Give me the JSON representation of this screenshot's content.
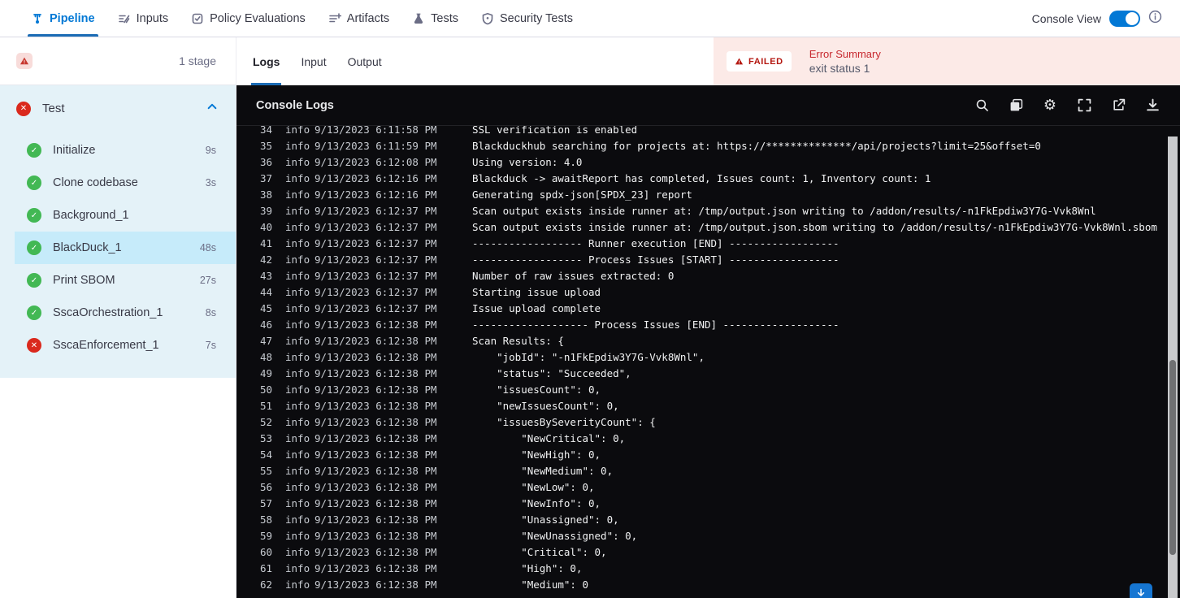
{
  "topnav": {
    "tabs": [
      {
        "label": "Pipeline",
        "icon": "pipeline-icon",
        "active": true
      },
      {
        "label": "Inputs",
        "icon": "inputs-icon"
      },
      {
        "label": "Policy Evaluations",
        "icon": "policy-evaluations-icon"
      },
      {
        "label": "Artifacts",
        "icon": "artifacts-icon"
      },
      {
        "label": "Tests",
        "icon": "tests-icon"
      },
      {
        "label": "Security Tests",
        "icon": "security-tests-icon"
      }
    ],
    "console_view_label": "Console View",
    "console_view_on": true
  },
  "sidebar": {
    "stage_count": "1 stage",
    "stage": {
      "name": "Test",
      "status": "failed"
    },
    "steps": [
      {
        "name": "Initialize",
        "duration": "9s",
        "status": "success"
      },
      {
        "name": "Clone codebase",
        "duration": "3s",
        "status": "success"
      },
      {
        "name": "Background_1",
        "duration": "",
        "status": "success"
      },
      {
        "name": "BlackDuck_1",
        "duration": "48s",
        "status": "success",
        "selected": true
      },
      {
        "name": "Print SBOM",
        "duration": "27s",
        "status": "success"
      },
      {
        "name": "SscaOrchestration_1",
        "duration": "8s",
        "status": "success"
      },
      {
        "name": "SscaEnforcement_1",
        "duration": "7s",
        "status": "failed"
      }
    ]
  },
  "main": {
    "tabs": [
      "Logs",
      "Input",
      "Output"
    ],
    "active_tab": "Logs",
    "error": {
      "badge": "FAILED",
      "title": "Error Summary",
      "message": "exit status 1"
    },
    "console": {
      "title": "Console Logs",
      "icons": [
        "search",
        "copy",
        "settings",
        "fullscreen",
        "open-in-new",
        "download"
      ],
      "logs": [
        {
          "num": 34,
          "level": "info",
          "time": "9/13/2023 6:11:58 PM",
          "msg": "SSL verification is enabled"
        },
        {
          "num": 35,
          "level": "info",
          "time": "9/13/2023 6:11:59 PM",
          "msg": "Blackduckhub searching for projects at: https://**************/api/projects?limit=25&offset=0"
        },
        {
          "num": 36,
          "level": "info",
          "time": "9/13/2023 6:12:08 PM",
          "msg": "Using version: 4.0"
        },
        {
          "num": 37,
          "level": "info",
          "time": "9/13/2023 6:12:16 PM",
          "msg": "Blackduck -> awaitReport has completed, Issues count: 1, Inventory count: 1"
        },
        {
          "num": 38,
          "level": "info",
          "time": "9/13/2023 6:12:16 PM",
          "msg": "Generating spdx-json[SPDX_23] report"
        },
        {
          "num": 39,
          "level": "info",
          "time": "9/13/2023 6:12:37 PM",
          "msg": "Scan output exists inside runner at: /tmp/output.json writing to /addon/results/-n1FkEpdiw3Y7G-Vvk8Wnl"
        },
        {
          "num": 40,
          "level": "info",
          "time": "9/13/2023 6:12:37 PM",
          "msg": "Scan output exists inside runner at: /tmp/output.json.sbom writing to /addon/results/-n1FkEpdiw3Y7G-Vvk8Wnl.sbom"
        },
        {
          "num": 41,
          "level": "info",
          "time": "9/13/2023 6:12:37 PM",
          "msg": "------------------ Runner execution [END] ------------------"
        },
        {
          "num": 42,
          "level": "info",
          "time": "9/13/2023 6:12:37 PM",
          "msg": "------------------ Process Issues [START] ------------------"
        },
        {
          "num": 43,
          "level": "info",
          "time": "9/13/2023 6:12:37 PM",
          "msg": "Number of raw issues extracted: 0"
        },
        {
          "num": 44,
          "level": "info",
          "time": "9/13/2023 6:12:37 PM",
          "msg": "Starting issue upload"
        },
        {
          "num": 45,
          "level": "info",
          "time": "9/13/2023 6:12:37 PM",
          "msg": "Issue upload complete"
        },
        {
          "num": 46,
          "level": "info",
          "time": "9/13/2023 6:12:38 PM",
          "msg": "------------------- Process Issues [END] -------------------"
        },
        {
          "num": 47,
          "level": "info",
          "time": "9/13/2023 6:12:38 PM",
          "msg": "Scan Results: {"
        },
        {
          "num": 48,
          "level": "info",
          "time": "9/13/2023 6:12:38 PM",
          "msg": "    \"jobId\": \"-n1FkEpdiw3Y7G-Vvk8Wnl\","
        },
        {
          "num": 49,
          "level": "info",
          "time": "9/13/2023 6:12:38 PM",
          "msg": "    \"status\": \"Succeeded\","
        },
        {
          "num": 50,
          "level": "info",
          "time": "9/13/2023 6:12:38 PM",
          "msg": "    \"issuesCount\": 0,"
        },
        {
          "num": 51,
          "level": "info",
          "time": "9/13/2023 6:12:38 PM",
          "msg": "    \"newIssuesCount\": 0,"
        },
        {
          "num": 52,
          "level": "info",
          "time": "9/13/2023 6:12:38 PM",
          "msg": "    \"issuesBySeverityCount\": {"
        },
        {
          "num": 53,
          "level": "info",
          "time": "9/13/2023 6:12:38 PM",
          "msg": "        \"NewCritical\": 0,"
        },
        {
          "num": 54,
          "level": "info",
          "time": "9/13/2023 6:12:38 PM",
          "msg": "        \"NewHigh\": 0,"
        },
        {
          "num": 55,
          "level": "info",
          "time": "9/13/2023 6:12:38 PM",
          "msg": "        \"NewMedium\": 0,"
        },
        {
          "num": 56,
          "level": "info",
          "time": "9/13/2023 6:12:38 PM",
          "msg": "        \"NewLow\": 0,"
        },
        {
          "num": 57,
          "level": "info",
          "time": "9/13/2023 6:12:38 PM",
          "msg": "        \"NewInfo\": 0,"
        },
        {
          "num": 58,
          "level": "info",
          "time": "9/13/2023 6:12:38 PM",
          "msg": "        \"Unassigned\": 0,"
        },
        {
          "num": 59,
          "level": "info",
          "time": "9/13/2023 6:12:38 PM",
          "msg": "        \"NewUnassigned\": 0,"
        },
        {
          "num": 60,
          "level": "info",
          "time": "9/13/2023 6:12:38 PM",
          "msg": "        \"Critical\": 0,"
        },
        {
          "num": 61,
          "level": "info",
          "time": "9/13/2023 6:12:38 PM",
          "msg": "        \"High\": 0,"
        },
        {
          "num": 62,
          "level": "info",
          "time": "9/13/2023 6:12:38 PM",
          "msg": "        \"Medium\": 0"
        }
      ]
    }
  },
  "colors": {
    "accent_blue": "#0278d5",
    "success_green": "#42b854",
    "fail_red": "#da291d",
    "error_bg": "#fceae7",
    "stage_bg": "#e4f2f8",
    "selected_step_bg": "#c6ebfa",
    "console_bg": "#0b0b0e"
  }
}
